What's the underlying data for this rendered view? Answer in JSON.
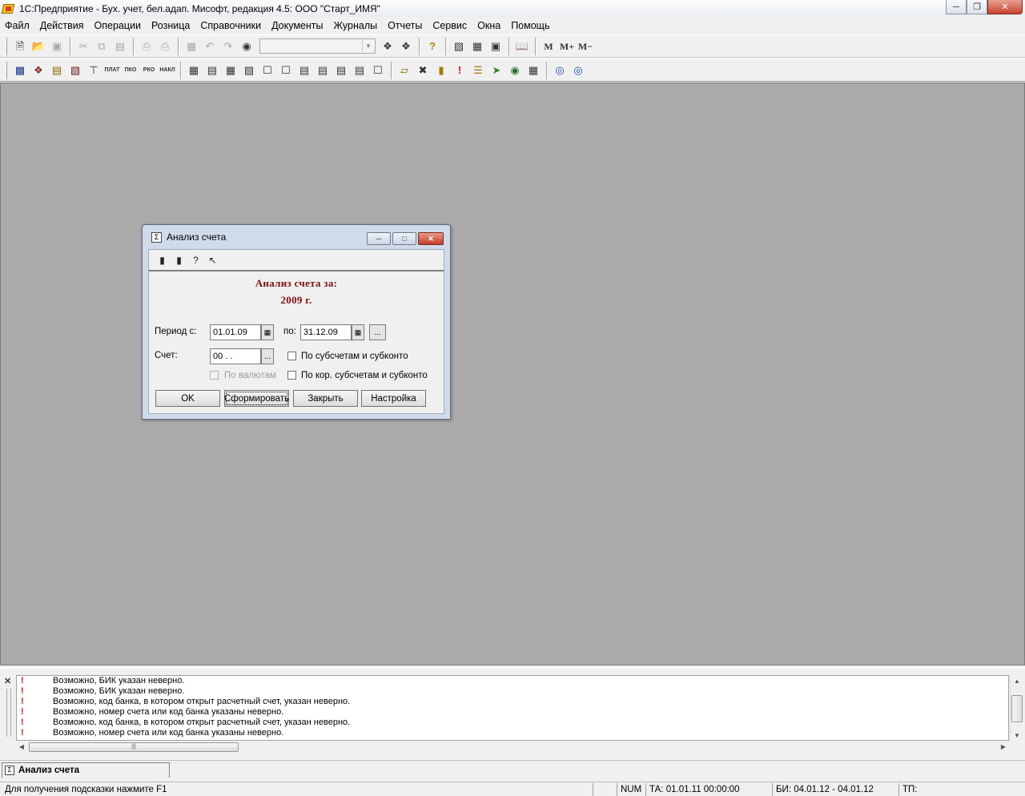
{
  "app": {
    "title": "1С:Предприятие - Бух. учет, бел.адап. Мисофт, редакция 4.5: ООО \"Старт_ИМЯ\""
  },
  "menu": [
    "Файл",
    "Действия",
    "Операции",
    "Розница",
    "Справочники",
    "Документы",
    "Журналы",
    "Отчеты",
    "Сервис",
    "Окна",
    "Помощь"
  ],
  "toolbar": {
    "text_buttons": [
      "M",
      "M+",
      "M−"
    ],
    "doc_labels": [
      "ПЛАТ",
      "ПКО",
      "РКО",
      "НАКЛ"
    ],
    "search_combo_value": ""
  },
  "dialog": {
    "title": "Анализ счета",
    "heading_line1": "Анализ счета за:",
    "heading_line2": "2009 г.",
    "period_label": "Период с:",
    "period_from": "01.01.09",
    "to_label": "по:",
    "period_to": "31.12.09",
    "account_label": "Счет:",
    "account_value": "00 .  .",
    "ellipsis": "...",
    "chk_subaccounts": "По субсчетам и субконто",
    "chk_currencies": "По валютам",
    "chk_corr_subaccounts": "По кор. субсчетам и субконто",
    "btn_ok": "OK",
    "btn_generate": "Сформировать",
    "btn_close": "Закрыть",
    "btn_settings": "Настройка"
  },
  "messages": [
    "Возможно, БИК указан неверно.",
    "Возможно, БИК указан неверно.",
    "Возможно, код банка, в котором открыт расчетный счет, указан неверно.",
    "Возможно, номер счета или код банка указаны неверно.",
    "Возможно, код банка, в котором открыт расчетный счет, указан неверно.",
    "Возможно, номер счета или код банка указаны неверно."
  ],
  "window_tab": "Анализ счета",
  "status": {
    "hint": "Для получения подсказки нажмите F1",
    "num": "NUM",
    "ta": "ТА: 01.01.11  00:00:00",
    "bi": "БИ: 04.01.12 - 04.01.12",
    "tp": "ТП:"
  }
}
